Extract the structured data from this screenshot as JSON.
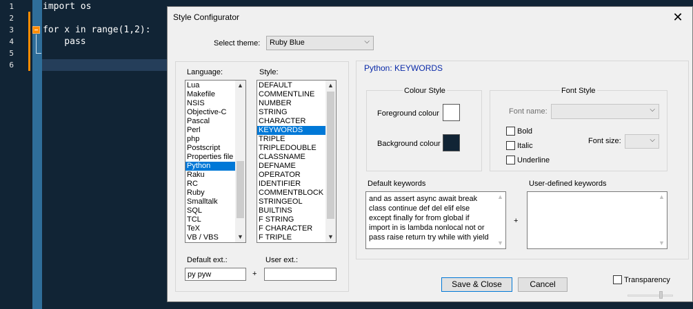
{
  "editor": {
    "line_numbers": [
      "1",
      "2",
      "3",
      "4",
      "5",
      "6"
    ],
    "code_lines": [
      "import os",
      "",
      "for x in range(1,2):",
      "    pass",
      "",
      ""
    ]
  },
  "dialog": {
    "title": "Style Configurator",
    "close_glyph": "✕",
    "select_theme_label": "Select theme:",
    "theme_value": "Ruby Blue",
    "language_label": "Language:",
    "style_label": "Style:",
    "languages": [
      "Lua",
      "Makefile",
      "NSIS",
      "Objective-C",
      "Pascal",
      "Perl",
      "php",
      "Postscript",
      "Properties file",
      "Python",
      "Raku",
      "RC",
      "Ruby",
      "Smalltalk",
      "SQL",
      "TCL",
      "TeX",
      "VB / VBS"
    ],
    "selected_language": "Python",
    "styles": [
      "DEFAULT",
      "COMMENTLINE",
      "NUMBER",
      "STRING",
      "CHARACTER",
      "KEYWORDS",
      "TRIPLE",
      "TRIPLEDOUBLE",
      "CLASSNAME",
      "DEFNAME",
      "OPERATOR",
      "IDENTIFIER",
      "COMMENTBLOCK",
      "STRINGEOL",
      "BUILTINS",
      "F STRING",
      "F CHARACTER",
      "F TRIPLE"
    ],
    "selected_style": "KEYWORDS",
    "default_ext_label": "Default ext.:",
    "default_ext_value": "py pyw",
    "plus": "+",
    "user_ext_label": "User ext.:",
    "user_ext_value": "",
    "section_title": "Python: KEYWORDS",
    "colour_style_label": "Colour Style",
    "foreground_label": "Foreground colour",
    "background_label": "Background colour",
    "foreground_color": "#ffffff",
    "background_color": "#112435",
    "font_style_label": "Font Style",
    "font_name_label": "Font name:",
    "font_name_value": "",
    "bold_label": "Bold",
    "italic_label": "Italic",
    "underline_label": "Underline",
    "font_size_label": "Font size:",
    "font_size_value": "",
    "default_keywords_label": "Default keywords",
    "default_keywords": "and as assert async await break class continue def del elif else except finally for from global if import in is lambda nonlocal not or pass raise return try while with yield",
    "user_keywords_label": "User-defined keywords",
    "user_keywords": "",
    "save_close_label": "Save & Close",
    "cancel_label": "Cancel",
    "transparency_label": "Transparency"
  },
  "colors": {
    "accent": "#0078d7",
    "section_title": "#0a2aa8",
    "editor_bg": "#112435",
    "change_marker": "#ff8c00"
  }
}
